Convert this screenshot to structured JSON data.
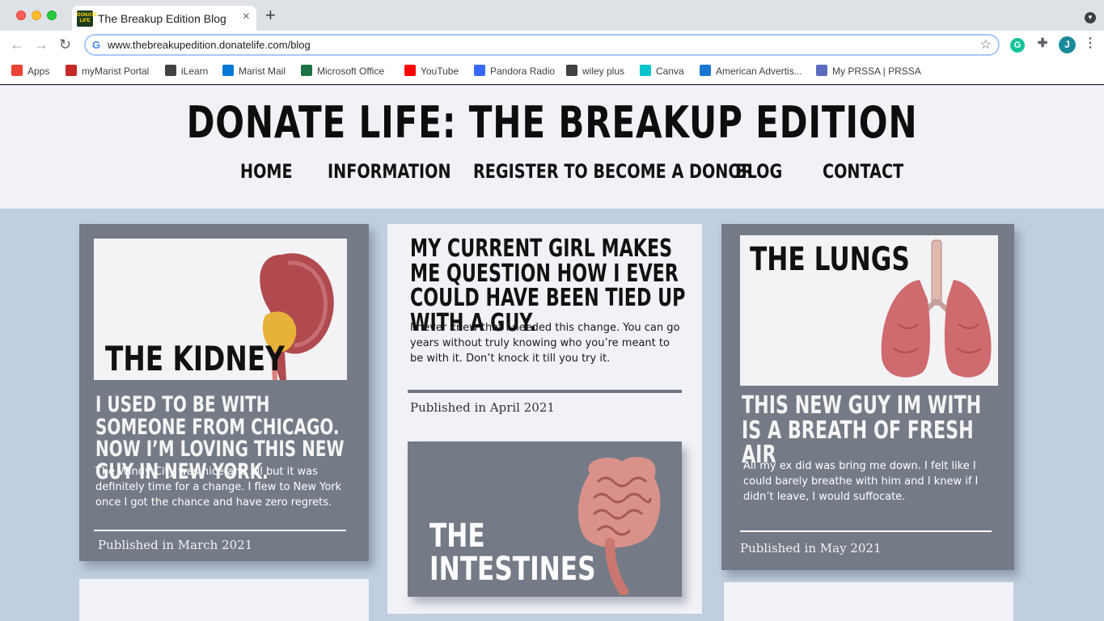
{
  "browser": {
    "tab_title": "The Breakup Edition Blog",
    "tab_favicon_text": "DONATE LIFE",
    "tab_close": "×",
    "new_tab": "+",
    "url": "www.thebreakupedition.donatelife.com/blog",
    "bookmarks": [
      {
        "label": "Apps",
        "color": "#ea4335"
      },
      {
        "label": "myMarist Portal",
        "color": "#c62828"
      },
      {
        "label": "iLearn",
        "color": "#424242"
      },
      {
        "label": "Marist Mail",
        "color": "#0078d4"
      },
      {
        "label": "Microsoft Office",
        "color": "#1e7145"
      },
      {
        "label": "YouTube",
        "color": "#ff0000"
      },
      {
        "label": "Pandora Radio",
        "color": "#3668ff"
      },
      {
        "label": "wiley plus",
        "color": "#424242"
      },
      {
        "label": "Canva",
        "color": "#00c4cc"
      },
      {
        "label": "American Advertis...",
        "color": "#1976d2"
      },
      {
        "label": "My PRSSA | PRSSA",
        "color": "#5c6bc0"
      }
    ],
    "avatar_letter": "J",
    "grammarly_letter": "G"
  },
  "site": {
    "title": "DONATE LIFE: THE BREAKUP EDITION",
    "nav": [
      "HOME",
      "INFORMATION",
      "REGISTER TO BECOME A DONOR",
      "BLOG",
      "CONTACT"
    ]
  },
  "posts": [
    {
      "image_label": "THE KIDNEY",
      "heading": "I used to be with someone from Chicago. Now I’m loving this new guy in New York.",
      "body": "The Windy City was nice and all but it was definitely time for a change. I flew to New York once I got the chance and have zero regrets.",
      "date": "Published in March 2021"
    },
    {
      "heading": "My current girl makes me question how I ever could have been tied up with a guy.",
      "body": "I never knew that I needed this change. You can go years without truly knowing who you’re meant to be with it. Don’t knock it till you try it.",
      "date": "Published in April 2021",
      "next_image_label_line1": "THE",
      "next_image_label_line2": "INTESTINES"
    },
    {
      "image_label": "THE LUNGS",
      "heading": "This new guy im with is a breath of fresh air",
      "body": "All my ex did was bring me down. I felt like I could barely breathe with him and I knew if I didn’t leave, I would suffocate.",
      "date": "Published in May 2021"
    }
  ],
  "colors": {
    "page_bg": "#c0cedf",
    "header_bg": "#f1f2f7",
    "card_dark": "#747b87",
    "card_light": "#f1f2f7"
  }
}
